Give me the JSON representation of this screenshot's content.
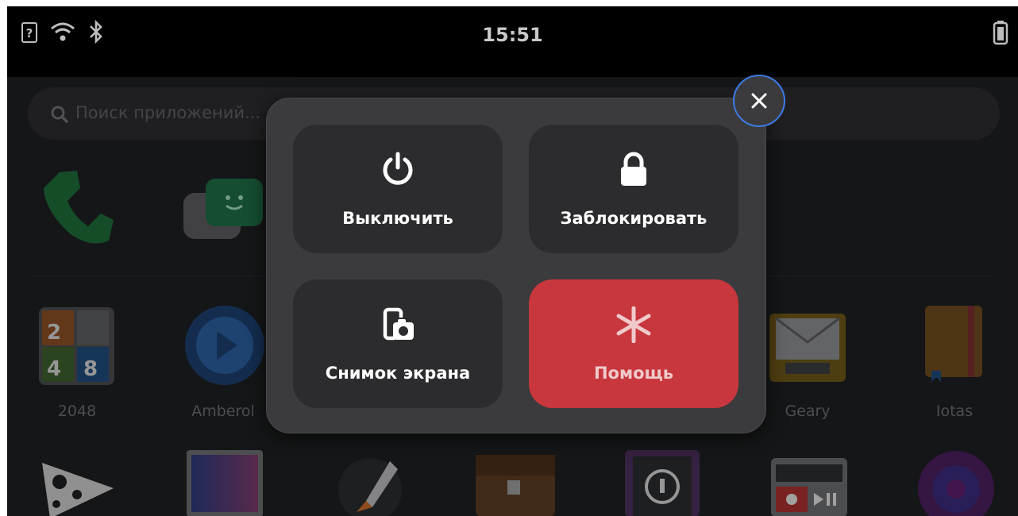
{
  "status_bar": {
    "time": "15:51",
    "icons": [
      "unknown-sim-icon",
      "wifi-icon",
      "bluetooth-icon",
      "battery-icon"
    ]
  },
  "launcher": {
    "search_placeholder": "Поиск приложений...",
    "apps_row2": [
      {
        "label": "2048",
        "icon": "2048-icon"
      },
      {
        "label": "Amberol",
        "icon": "amberol-icon"
      },
      {
        "label": "Geary",
        "icon": "geary-icon"
      },
      {
        "label": "Iotas",
        "icon": "iotas-icon"
      }
    ],
    "apps_row1_icons": [
      "phone-icon",
      "chat-icon"
    ],
    "apps_row3_icons": [
      "cow-app-icon",
      "spectrum-app-icon",
      "rocket-app-icon",
      "briefcase-app-icon",
      "password-app-icon",
      "media-app-icon",
      "spiral-app-icon"
    ]
  },
  "power_menu": {
    "shutdown_label": "Выключить",
    "lock_label": "Заблокировать",
    "screenshot_label": "Снимок экрана",
    "help_label": "Помощь",
    "help_color": "#c7373d",
    "close_ring_color": "#3d7ae6"
  }
}
